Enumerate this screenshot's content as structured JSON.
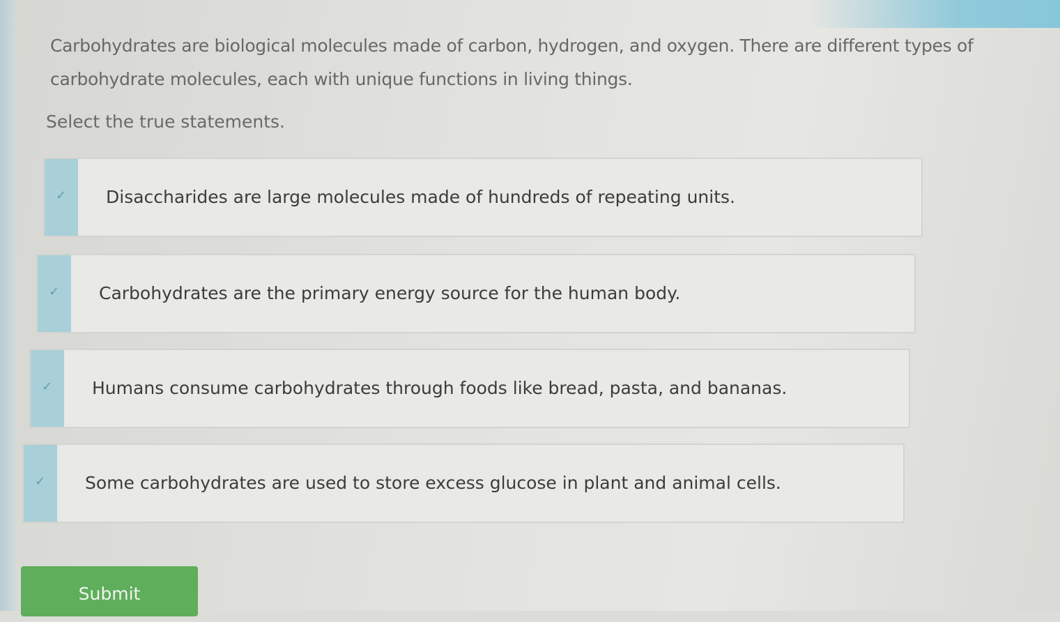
{
  "question": {
    "prompt": "Carbohydrates are biological molecules made of carbon, hydrogen, and oxygen. There are different types of carbohydrate molecules, each with unique functions in living things.",
    "instruction": "Select the true statements."
  },
  "options": [
    {
      "label": "Disaccharides are large molecules made of hundreds of repeating units.",
      "checkbox_icon": "check-icon"
    },
    {
      "label": "Carbohydrates are the primary energy source for the human body.",
      "checkbox_icon": "check-icon"
    },
    {
      "label": "Humans consume carbohydrates through foods like bread, pasta, and bananas.",
      "checkbox_icon": "check-icon"
    },
    {
      "label": "Some carbohydrates are used to store excess glucose in plant and animal cells.",
      "checkbox_icon": "check-icon"
    }
  ],
  "submit": {
    "label": "Submit"
  },
  "colors": {
    "checkbox": "#a9cfd8",
    "submit": "#5fae5c",
    "accent_bar": "#86c7da"
  }
}
